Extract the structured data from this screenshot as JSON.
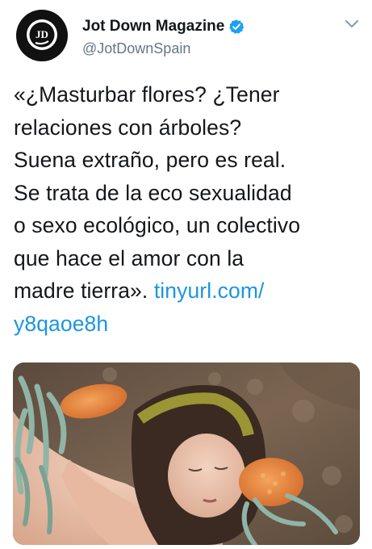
{
  "account": {
    "display_name": "Jot Down Magazine",
    "handle": "@JotDownSpain",
    "verified": true,
    "avatar_icon": "jot-down-logo",
    "avatar_letters": "JD"
  },
  "tweet": {
    "lines": [
      "«¿Masturbar flores? ¿Tener",
      "relaciones con árboles?",
      "Suena extraño, pero es real.",
      "Se trata de la eco sexualidad",
      "o sexo ecológico, un colectivo",
      "que hace el amor con la",
      "madre tierra»."
    ],
    "link_part1": "tinyurl.com/",
    "link_part2": "y8qaoe8h"
  },
  "colors": {
    "link": "#1b95e0",
    "verified": "#1da1f2",
    "secondary_text": "#657786"
  },
  "icons": {
    "verified": "verified-badge-icon",
    "menu": "chevron-down-icon"
  }
}
